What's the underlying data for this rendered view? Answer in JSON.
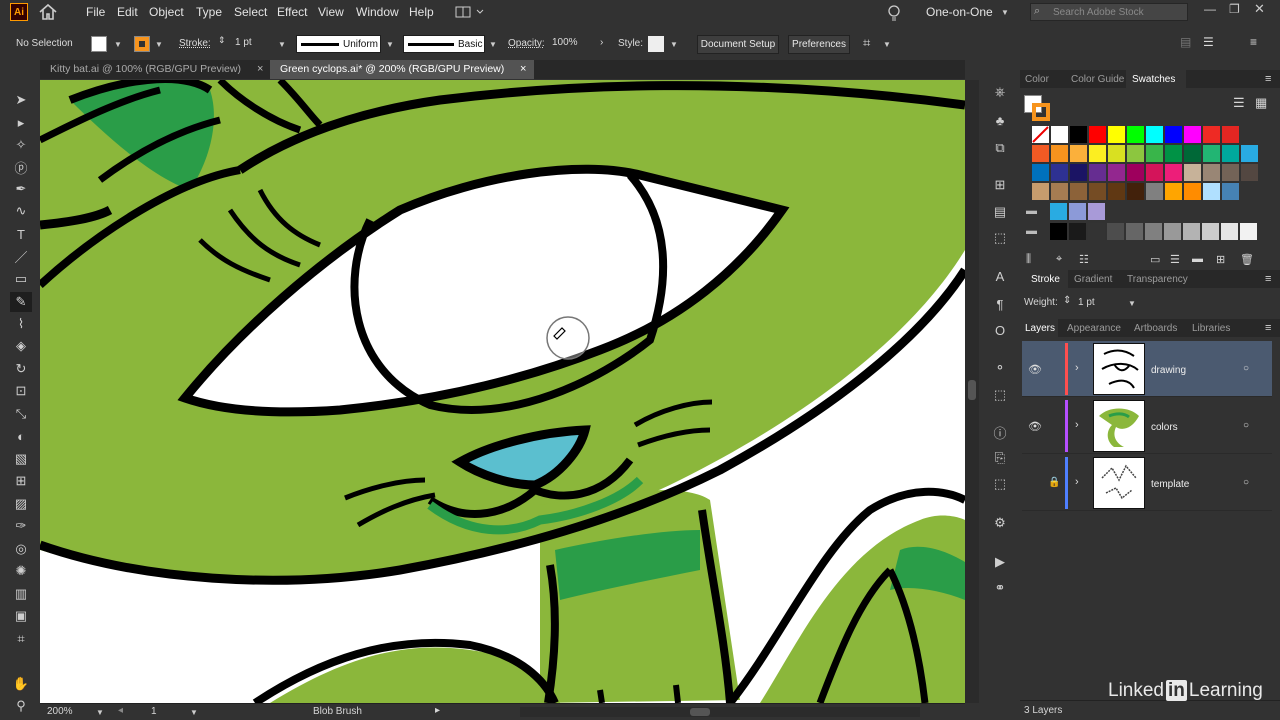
{
  "app": {
    "logo_text": "Ai"
  },
  "menu": [
    "File",
    "Edit",
    "Object",
    "Type",
    "Select",
    "Effect",
    "View",
    "Window",
    "Help"
  ],
  "workspace": "One-on-One",
  "search_placeholder": "Search Adobe Stock",
  "control": {
    "selection": "No Selection",
    "stroke_label": "Stroke:",
    "stroke_weight": "1 pt",
    "stroke_profile": "Uniform",
    "brush": "Basic",
    "opacity_label": "Opacity:",
    "opacity_value": "100%",
    "style_label": "Style:",
    "document_setup": "Document Setup",
    "preferences": "Preferences"
  },
  "tabs": [
    {
      "label": "Kitty bat.ai @ 100% (RGB/GPU Preview)",
      "active": false
    },
    {
      "label": "Green cyclops.ai* @ 200% (RGB/GPU Preview)",
      "active": true
    }
  ],
  "status": {
    "zoom": "200%",
    "artboard": "1",
    "tool": "Blob Brush"
  },
  "panel_color": {
    "tabs": [
      "Color",
      "Color Guide",
      "Swatches"
    ],
    "active": "Swatches"
  },
  "swatch_rows": [
    [
      "#ffffff",
      "#ffffff",
      "#000000",
      "#ff0000",
      "#ffff00",
      "#00ff00",
      "#00ffff",
      "#0000ff",
      "#ff00ff",
      "#ee2a24",
      "#e32622"
    ],
    [
      "#f15a24",
      "#f7931e",
      "#fbb03b",
      "#fcee21",
      "#d9e021",
      "#8cc63f",
      "#39b54a",
      "#009245",
      "#006837",
      "#22b573",
      "#00a99d",
      "#29abe2"
    ],
    [
      "#0071bc",
      "#2e3192",
      "#1b1464",
      "#662d91",
      "#93278f",
      "#9e005d",
      "#d4145a",
      "#ed1e79",
      "#c7b299",
      "#998675",
      "#736357",
      "#534741"
    ],
    [
      "#c69c6d",
      "#a67c52",
      "#8c6239",
      "#754c24",
      "#603813",
      "#42210b",
      "#808080",
      "#ffa500",
      "#ff8c00",
      "#b0e0ff",
      "#4682b4"
    ],
    [
      "#29abe2",
      "#8c9ad8",
      "#a89ad8"
    ],
    [
      "#000000",
      "#1a1a1a",
      "#333333",
      "#4d4d4d",
      "#666666",
      "#808080",
      "#999999",
      "#b3b3b3",
      "#cccccc",
      "#e6e6e6",
      "#f2f2f2"
    ]
  ],
  "panel_stroke": {
    "tabs": [
      "Stroke",
      "Gradient",
      "Transparency"
    ],
    "active": "Stroke",
    "weight_label": "Weight:",
    "weight_value": "1 pt"
  },
  "panel_layers": {
    "tabs": [
      "Layers",
      "Appearance",
      "Artboards",
      "Libraries"
    ],
    "active": "Layers",
    "layers": [
      {
        "name": "drawing",
        "color": "#ff4f4f",
        "visible": true,
        "locked": false,
        "selected": true
      },
      {
        "name": "colors",
        "color": "#b64fff",
        "visible": true,
        "locked": false,
        "selected": false
      },
      {
        "name": "template",
        "color": "#4f80ff",
        "visible": false,
        "locked": true,
        "selected": false
      }
    ],
    "count": "3 Layers"
  },
  "watermark": {
    "brand": "Linked",
    "in": "in",
    "suffix": "Learning"
  },
  "icon_names": [
    "home-icon",
    "arrange-icon",
    "lightbulb-icon",
    "search-icon",
    "selection-tool-icon",
    "direct-selection-icon",
    "magic-wand-icon",
    "lasso-icon",
    "pen-icon",
    "curvature-icon",
    "type-icon",
    "line-icon",
    "rectangle-icon",
    "blob-brush-icon",
    "shaper-icon",
    "eraser-icon",
    "rotate-icon",
    "scale-icon",
    "free-transform-icon",
    "shape-builder-icon",
    "perspective-icon",
    "mesh-icon",
    "gradient-icon",
    "eyedropper-icon",
    "blend-icon",
    "symbol-sprayer-icon",
    "graph-icon",
    "artboard-icon",
    "slice-icon",
    "hand-icon",
    "zoom-icon"
  ]
}
